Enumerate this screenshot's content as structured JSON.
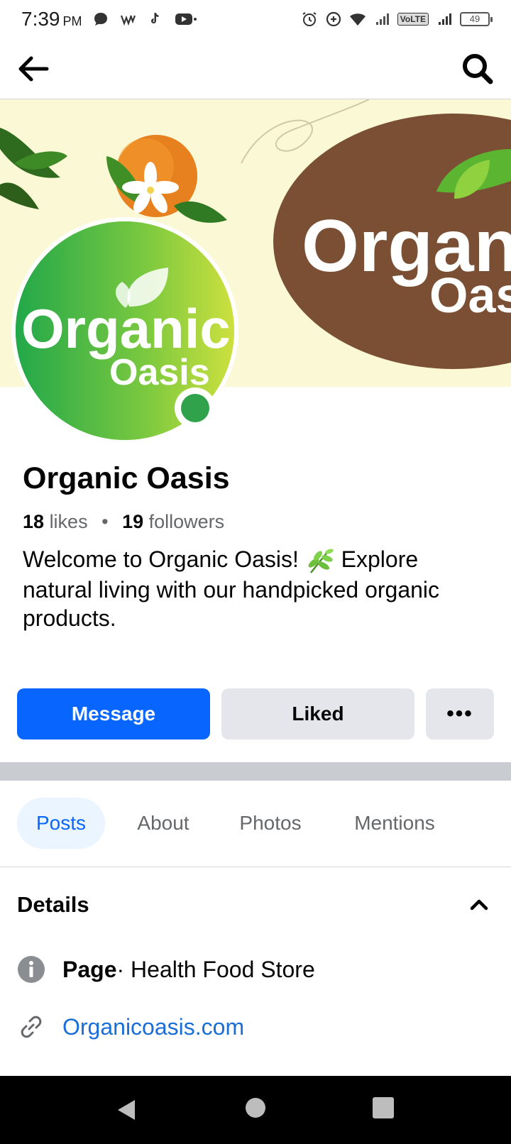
{
  "status": {
    "time": "7:39",
    "ampm": "PM",
    "network_label": "VoLTE",
    "battery": "49"
  },
  "cover": {
    "brand_word_1": "Organic",
    "brand_word_2": "Oasis"
  },
  "profile": {
    "name": "Organic Oasis",
    "likes_count": "18",
    "likes_label": "likes",
    "separator": "•",
    "followers_count": "19",
    "followers_label": "followers",
    "bio_part1": "Welcome to Organic Oasis!",
    "bio_part2": "Explore natural living with our handpicked organic products."
  },
  "actions": {
    "message_label": "Message",
    "liked_label": "Liked",
    "more_label": "•••"
  },
  "tabs": [
    {
      "label": "Posts",
      "active": true
    },
    {
      "label": "About",
      "active": false
    },
    {
      "label": "Photos",
      "active": false
    },
    {
      "label": "Mentions",
      "active": false
    }
  ],
  "details": {
    "title": "Details",
    "page_label": "Page",
    "page_category": " · Health Food Store",
    "website": "Organicoasis.com"
  },
  "colors": {
    "primary": "#0866ff",
    "online": "#31a24c",
    "cover_bg": "#fbf9d5",
    "oval_brown": "#7b4f33"
  }
}
